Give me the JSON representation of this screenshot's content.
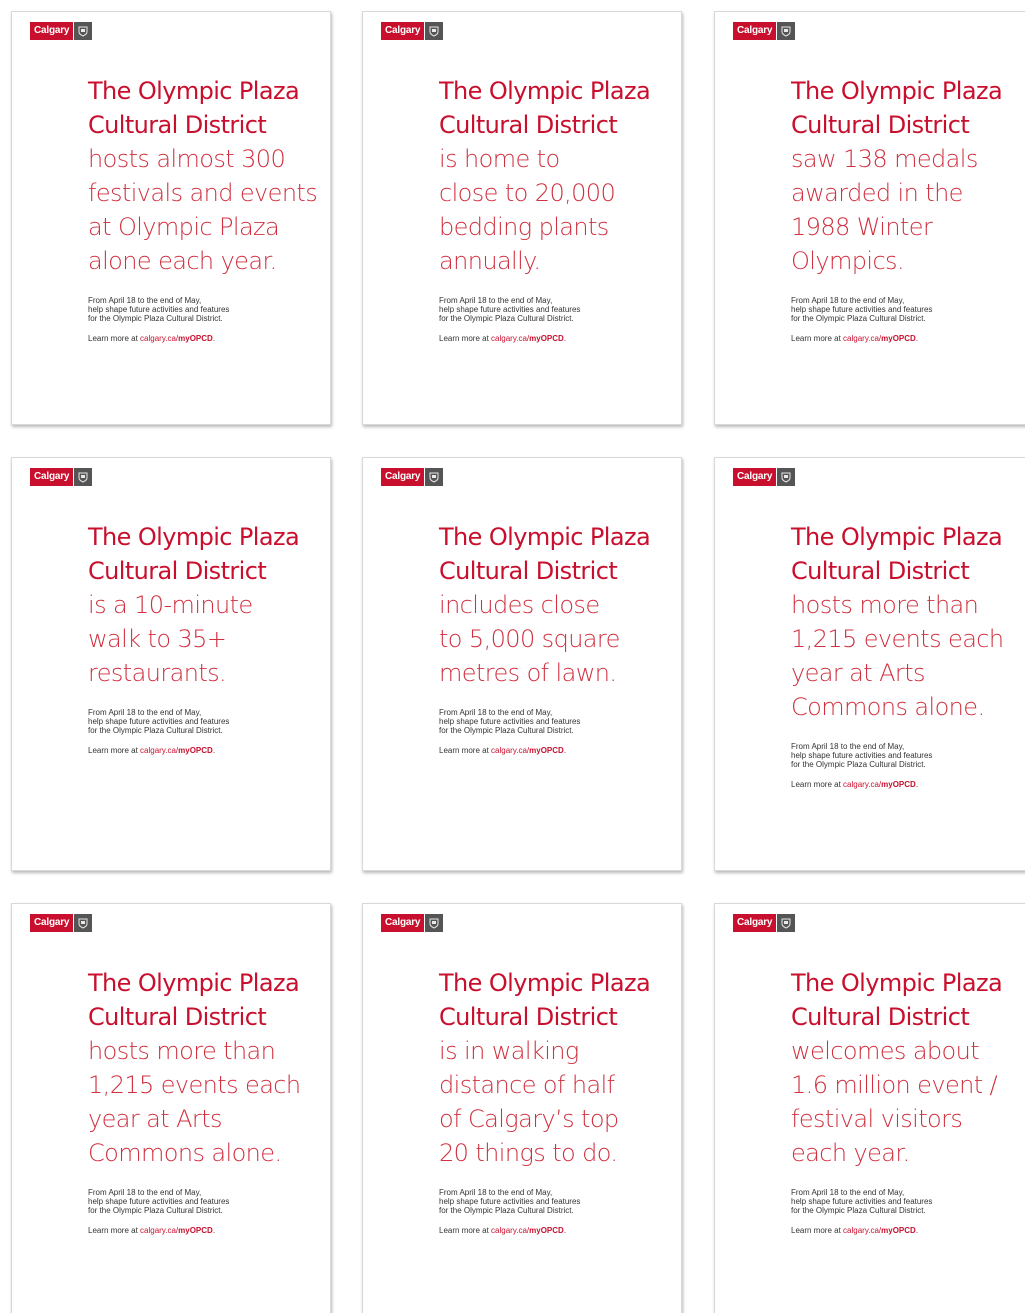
{
  "brand": {
    "logo_text": "Calgary",
    "crest_icon": "city-crest-icon",
    "accent_color": "#c8102e"
  },
  "posters": [
    {
      "title_line1": "The Olympic Plaza",
      "title_line2": "Cultural District",
      "fact": "hosts almost 300\nfestivals and events\nat Olympic Plaza\nalone each year.",
      "body": "From April 18 to the end of May,\nhelp shape future activities and features\nfor the Olympic Plaza Cultural District.",
      "learn_prefix": "Learn more at ",
      "link_domain": "calgary.ca/",
      "link_path": "myOPCD",
      "learn_suffix": "."
    },
    {
      "title_line1": "The Olympic Plaza",
      "title_line2": "Cultural District",
      "fact": "is home to\nclose to 20,000\nbedding plants\nannually.",
      "body": "From April 18 to the end of May,\nhelp shape future activities and features\nfor the Olympic Plaza Cultural District.",
      "learn_prefix": "Learn more at ",
      "link_domain": "calgary.ca/",
      "link_path": "myOPCD",
      "learn_suffix": "."
    },
    {
      "title_line1": "The Olympic Plaza",
      "title_line2": "Cultural District",
      "fact": "saw 138 medals\nawarded in the\n1988 Winter\nOlympics.",
      "body": "From April 18 to the end of May,\nhelp shape future activities and features\nfor the Olympic Plaza Cultural District.",
      "learn_prefix": "Learn more at ",
      "link_domain": "calgary.ca/",
      "link_path": "myOPCD",
      "learn_suffix": "."
    },
    {
      "title_line1": "The Olympic Plaza",
      "title_line2": "Cultural District",
      "fact": "is a 10-minute\nwalk to 35+\nrestaurants.",
      "body": "From April 18 to the end of May,\nhelp shape future activities and features\nfor the Olympic Plaza Cultural District.",
      "learn_prefix": "Learn more at ",
      "link_domain": "calgary.ca/",
      "link_path": "myOPCD",
      "learn_suffix": "."
    },
    {
      "title_line1": "The Olympic Plaza",
      "title_line2": "Cultural District",
      "fact": "includes close\nto 5,000 square\nmetres of lawn.",
      "body": "From April 18 to the end of May,\nhelp shape future activities and features\nfor the Olympic Plaza Cultural District.",
      "learn_prefix": "Learn more at ",
      "link_domain": "calgary.ca/",
      "link_path": "myOPCD",
      "learn_suffix": "."
    },
    {
      "title_line1": "The Olympic Plaza",
      "title_line2": "Cultural District",
      "fact": "hosts more than\n1,215 events each\nyear at Arts\nCommons alone.",
      "body": "From April 18 to the end of May,\nhelp shape future activities and features\nfor the Olympic Plaza Cultural District.",
      "learn_prefix": "Learn more at ",
      "link_domain": "calgary.ca/",
      "link_path": "myOPCD",
      "learn_suffix": "."
    },
    {
      "title_line1": "The Olympic Plaza",
      "title_line2": "Cultural District",
      "fact": "hosts more than\n1,215 events each\nyear at Arts\nCommons alone.",
      "body": "From April 18 to the end of May,\nhelp shape future activities and features\nfor the Olympic Plaza Cultural District.",
      "learn_prefix": "Learn more at ",
      "link_domain": "calgary.ca/",
      "link_path": "myOPCD",
      "learn_suffix": "."
    },
    {
      "title_line1": "The Olympic Plaza",
      "title_line2": "Cultural District",
      "fact": "is in walking\ndistance of half\nof Calgary’s top\n20 things to do.",
      "body": "From April 18 to the end of May,\nhelp shape future activities and features\nfor the Olympic Plaza Cultural District.",
      "learn_prefix": "Learn more at ",
      "link_domain": "calgary.ca/",
      "link_path": "myOPCD",
      "learn_suffix": "."
    },
    {
      "title_line1": "The Olympic Plaza",
      "title_line2": "Cultural District",
      "fact": "welcomes about\n1.6 million event /\nfestival visitors\neach year.",
      "body": "From April 18 to the end of May,\nhelp shape future activities and features\nfor the Olympic Plaza Cultural District.",
      "learn_prefix": "Learn more at ",
      "link_domain": "calgary.ca/",
      "link_path": "myOPCD",
      "learn_suffix": "."
    }
  ]
}
